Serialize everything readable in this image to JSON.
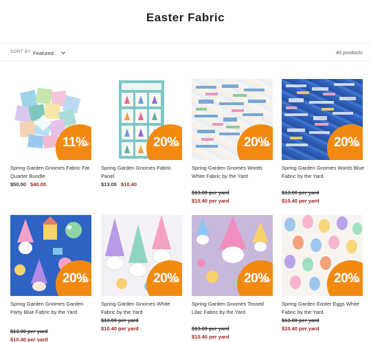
{
  "page": {
    "title": "Easter Fabric"
  },
  "toolbar": {
    "sort_label": "SORT BY",
    "sort_value": "Featured",
    "product_count": "46 products"
  },
  "badge_off": "OFF",
  "colors": {
    "badge": "#f28a12",
    "sale_price": "#a02020"
  },
  "products": [
    {
      "name": "Spring Garden Gnomes Fabric Fat Quarter Bundle",
      "badge": "11%",
      "regular": "$50.00",
      "sale": "$40.00"
    },
    {
      "name": "Spring Garden Gnomes Fabric Panel",
      "badge": "20%",
      "regular": "$13.00",
      "sale": "$10.40"
    },
    {
      "name": "Spring Garden Gnomes Words White Fabric by the Yard",
      "badge": "20%",
      "regular": "$13.00 per yard",
      "sale": "$10.40 per yard"
    },
    {
      "name": "Spring Garden Gnomes Words Blue Fabric by the Yard",
      "badge": "20%",
      "regular": "$13.00 per yard",
      "sale": "$10.40 per yard"
    },
    {
      "name": "Spring Garden Gnomes Garden Party Blue Fabric by the Yard",
      "badge": "20%",
      "regular": "$13.00 per yard",
      "sale": "$10.40 per yard"
    },
    {
      "name": "Spring Garden Gnomes White Fabric by the Yard",
      "badge": "20%",
      "regular": "$13.00 per yard",
      "sale": "$10.40 per yard"
    },
    {
      "name": "Spring Garden Gnomes Tossed Lilac Fabric by the Yard",
      "badge": "20%",
      "regular": "$13.00 per yard",
      "sale": "$10.40 per yard"
    },
    {
      "name": "Spring Garden Easter Eggs White Fabric by the Yard",
      "badge": "20%",
      "regular": "$13.00 per yard",
      "sale": "$10.40 per yard"
    }
  ]
}
